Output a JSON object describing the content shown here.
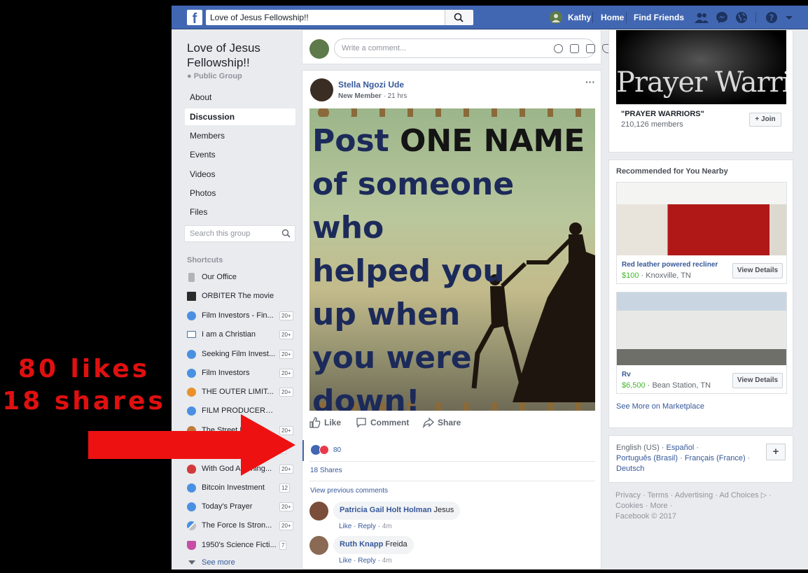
{
  "annotation": {
    "line1": "80 likes",
    "line2": "18 shares",
    "arrow_color": "#e01010"
  },
  "topbar": {
    "logo": "f",
    "search_value": "Love of Jesus Fellowship!!",
    "user_name": "Kathy",
    "home_label": "Home",
    "find_friends_label": "Find Friends",
    "icons": [
      "friends-icon",
      "messenger-icon",
      "globe-icon",
      "help-icon",
      "dropdown-icon"
    ],
    "brand_color": "#4267b2"
  },
  "group": {
    "title": "Love of Jesus Fellowship!!",
    "type": "Public Group",
    "nav": [
      "About",
      "Discussion",
      "Members",
      "Events",
      "Videos",
      "Photos",
      "Files"
    ],
    "active_nav": "Discussion",
    "search_placeholder": "Search this group",
    "shortcuts_heading": "Shortcuts",
    "shortcuts": [
      {
        "label": "Our Office",
        "count": "",
        "icon": "office-icon"
      },
      {
        "label": "ORBITER The movie",
        "count": "",
        "icon": "star-icon"
      },
      {
        "label": "Film Investors - Fin...",
        "count": "20+",
        "icon": "group-icon"
      },
      {
        "label": "I am a Christian",
        "count": "20+",
        "icon": "book-icon"
      },
      {
        "label": "Seeking Film Invest...",
        "count": "20+",
        "icon": "group-icon"
      },
      {
        "label": "Film Investors",
        "count": "20+",
        "icon": "group-icon"
      },
      {
        "label": "THE OUTER LIMIT...",
        "count": "20+",
        "icon": "planet-icon"
      },
      {
        "label": "FILM PRODUCERS,FIN...",
        "count": "",
        "icon": "group-icon"
      },
      {
        "label": "The Street Pr...",
        "count": "20+",
        "icon": "street-icon"
      },
      {
        "label": "",
        "count": "3",
        "icon": "group-icon"
      },
      {
        "label": "With God All Thing...",
        "count": "20+",
        "icon": "heart-icon"
      },
      {
        "label": "Bitcoin Investment",
        "count": "12",
        "icon": "group-icon"
      },
      {
        "label": "Today's Prayer",
        "count": "20+",
        "icon": "group-icon"
      },
      {
        "label": "The Force Is Stron...",
        "count": "20+",
        "icon": "force-icon"
      },
      {
        "label": "1950's Science Ficti...",
        "count": "7",
        "icon": "flask-icon"
      }
    ],
    "see_more": "See more"
  },
  "composer": {
    "placeholder": "Write a comment..."
  },
  "post": {
    "author": "Stella Ngozi Ude",
    "badge": "New Member",
    "time": "21 hrs",
    "image_text": {
      "line1a": "Post ",
      "line1b": "ONE NAME",
      "line2": "of someone who",
      "line3": "helped you",
      "line4": "up when",
      "line5": "you were",
      "line6": "down!"
    },
    "actions": {
      "like": "Like",
      "comment": "Comment",
      "share": "Share"
    },
    "reaction_count": "80",
    "shares": "18 Shares",
    "view_previous": "View previous comments",
    "comments": [
      {
        "name": "Patricia Gail Holt Holman",
        "text": "Jesus",
        "like": "Like",
        "reply": "Reply",
        "time": "4m"
      },
      {
        "name": "Ruth Knapp",
        "text": "Freida",
        "like": "Like",
        "reply": "Reply",
        "time": "4m"
      }
    ]
  },
  "suggested_group": {
    "image_text": "Prayer Warriors",
    "name": "\"PRAYER WARRIORS\"",
    "members": "210,126 members",
    "join_label": "+ Join"
  },
  "marketplace": {
    "title": "Recommended for You Nearby",
    "items": [
      {
        "name": "Red leather powered recliner",
        "price": "$100",
        "location": "Knoxville, TN",
        "button": "View Details"
      },
      {
        "name": "Rv",
        "price": "$6,500",
        "location": "Bean Station, TN",
        "button": "View Details"
      }
    ],
    "see_more": "See More on Marketplace"
  },
  "languages": {
    "current": "English (US)",
    "others": [
      "Español",
      "Português (Brasil)",
      "Français (France)",
      "Deutsch"
    ]
  },
  "footer": {
    "links": [
      "Privacy",
      "Terms",
      "Advertising",
      "Ad Choices",
      "Cookies",
      "More"
    ],
    "copyright": "Facebook © 2017"
  }
}
